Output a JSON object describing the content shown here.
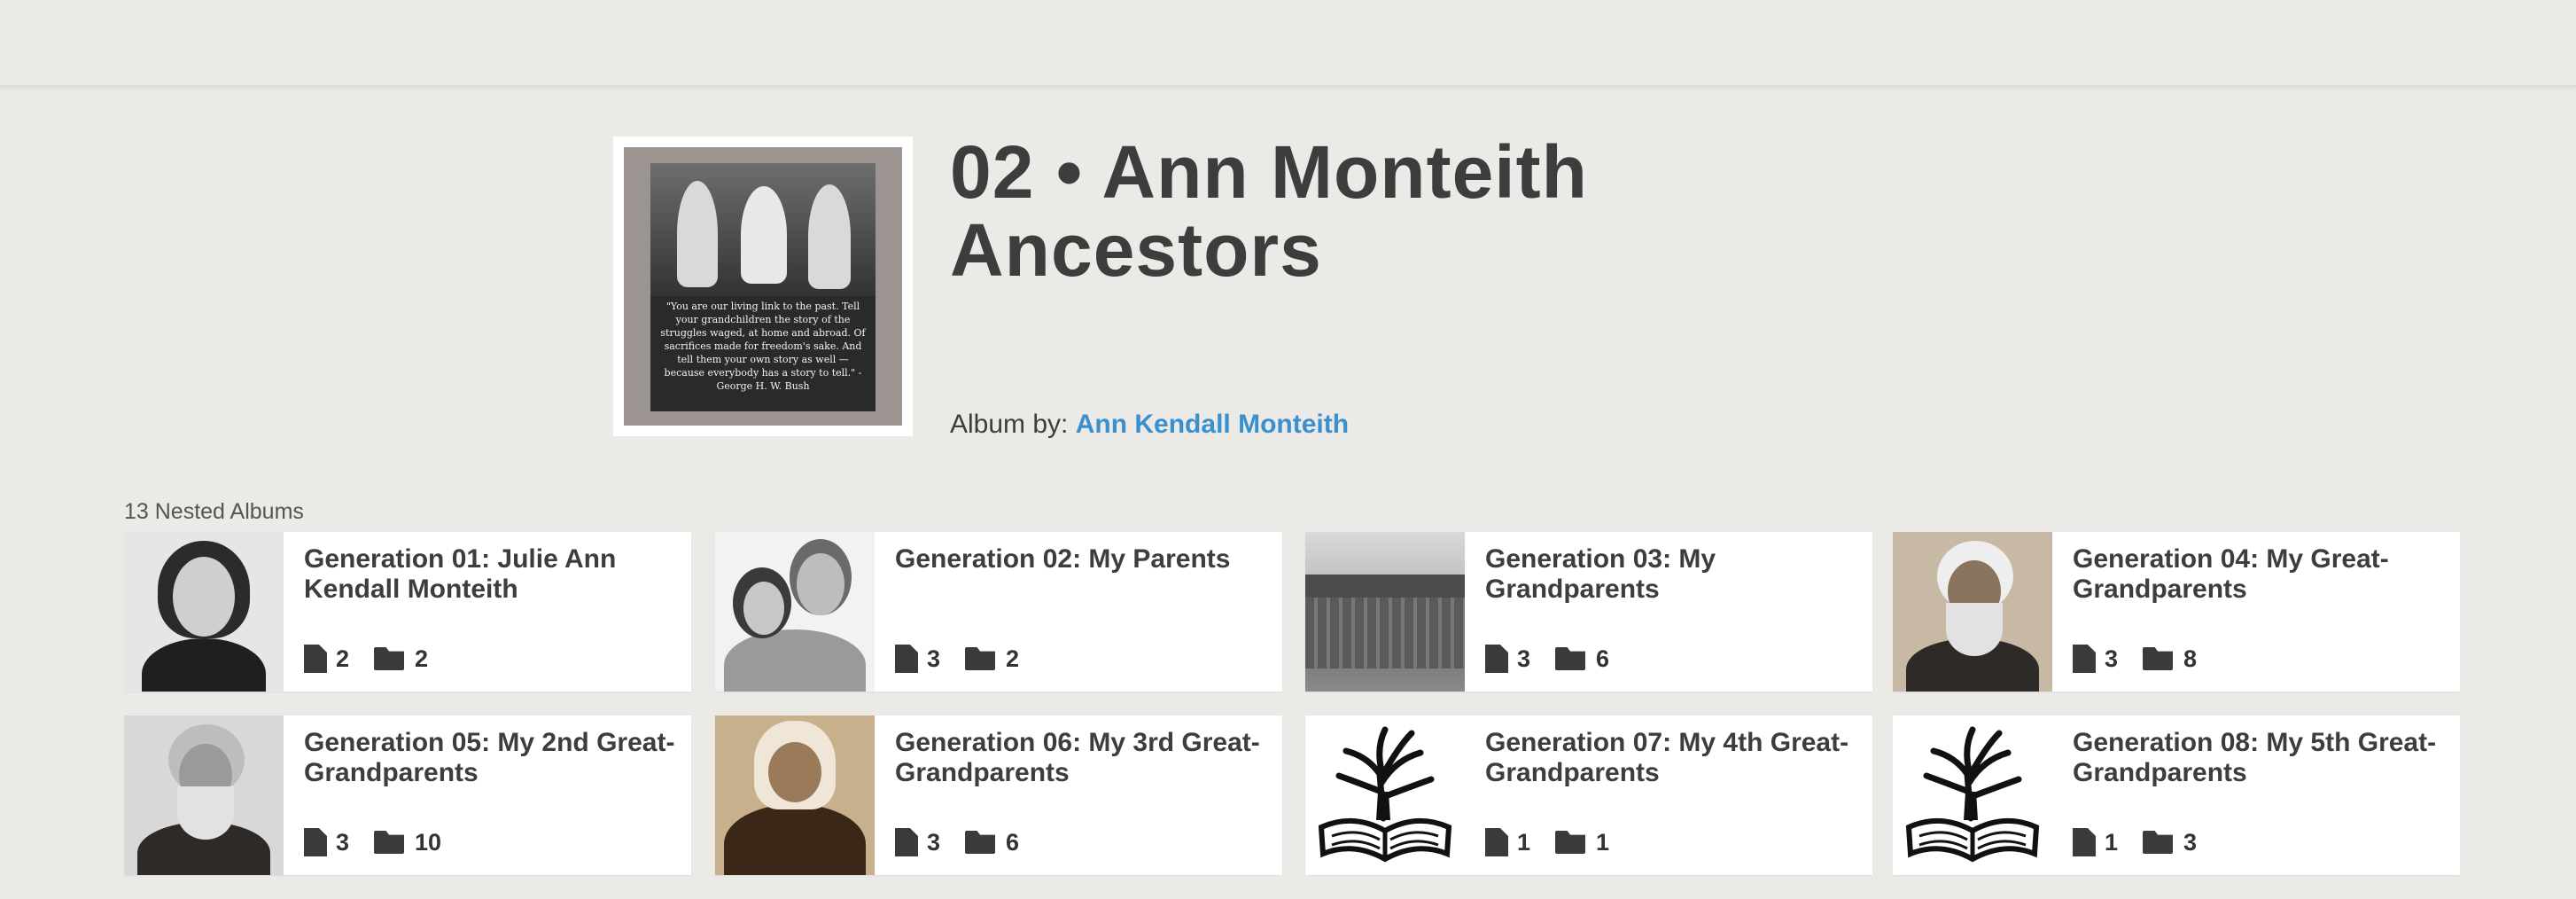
{
  "album": {
    "title": "02 • Ann Monteith Ancestors",
    "by_label": "Album by:",
    "owner": "Ann Kendall Monteith",
    "cover_quote": "\"You are our living link to the past. Tell your grandchildren the story of the struggles waged, at home and abroad. Of sacrifices made for freedom's sake. And tell them your own story as well — because everybody has a story to tell.\" -George H. W. Bush"
  },
  "nested": {
    "label": "13 Nested Albums",
    "albums": [
      {
        "title": "Generation 01: Julie Ann Kendall Monteith",
        "docs": "2",
        "folders": "2",
        "thumb": "portrait"
      },
      {
        "title": "Generation 02: My Parents",
        "docs": "3",
        "folders": "2",
        "thumb": "couple"
      },
      {
        "title": "Generation 03: My Grandparents",
        "docs": "3",
        "folders": "6",
        "thumb": "house"
      },
      {
        "title": "Generation 04: My Great-Grandparents",
        "docs": "3",
        "folders": "8",
        "thumb": "old-man"
      },
      {
        "title": "Generation 05: My 2nd Great-Grandparents",
        "docs": "3",
        "folders": "10",
        "thumb": "old-man"
      },
      {
        "title": "Generation 06: My 3rd Great-Grandparents",
        "docs": "3",
        "folders": "6",
        "thumb": "sepia-woman"
      },
      {
        "title": "Generation 07: My 4th Great-Grandparents",
        "docs": "1",
        "folders": "1",
        "thumb": "tree-book"
      },
      {
        "title": "Generation 08: My 5th Great-Grandparents",
        "docs": "1",
        "folders": "3",
        "thumb": "tree-book"
      }
    ]
  },
  "colors": {
    "background": "#ebeae7",
    "link": "#3a8fce",
    "text": "#3d3d3d"
  }
}
